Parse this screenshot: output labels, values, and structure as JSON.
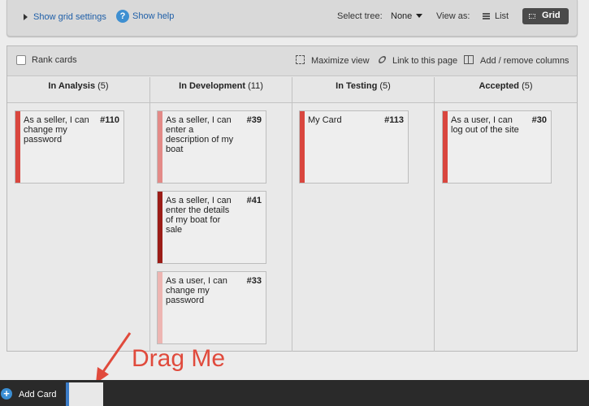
{
  "settings": {
    "show_grid_settings": "Show grid settings",
    "help_icon_glyph": "?",
    "show_help": "Show help",
    "select_tree_label": "Select tree:",
    "select_tree_value": "None",
    "view_as_label": "View as:",
    "list_label": "List",
    "grid_label": "Grid"
  },
  "toolbar": {
    "rank_cards": "Rank cards",
    "maximize_view": "Maximize view",
    "link_to_page": "Link to this page",
    "add_remove_columns": "Add / remove columns"
  },
  "columns": [
    {
      "title": "In Analysis",
      "count": "(5)",
      "cards": [
        {
          "text": "As a seller, I can change my password",
          "id": "#110",
          "color": "#d9463e"
        }
      ]
    },
    {
      "title": "In Development",
      "count": "(11)",
      "cards": [
        {
          "text": "As a seller, I can enter a description of my boat",
          "id": "#39",
          "color": "#e38a87"
        },
        {
          "text": "As a seller, I can enter the details of my boat for sale",
          "id": "#41",
          "color": "#9b1c17"
        },
        {
          "text": "As a user, I can change my password",
          "id": "#33",
          "color": "#edb5b2"
        }
      ]
    },
    {
      "title": "In Testing",
      "count": "(5)",
      "cards": [
        {
          "text": "My Card",
          "id": "#113",
          "color": "#d9463e"
        }
      ]
    },
    {
      "title": "Accepted",
      "count": "(5)",
      "cards": [
        {
          "text": "As a user, I can log out of the site",
          "id": "#30",
          "color": "#d9463e"
        }
      ]
    }
  ],
  "annotation": {
    "drag_me": "Drag Me",
    "color": "#e04a3c"
  },
  "bottom": {
    "add_icon_glyph": "+",
    "add_card": "Add Card"
  }
}
